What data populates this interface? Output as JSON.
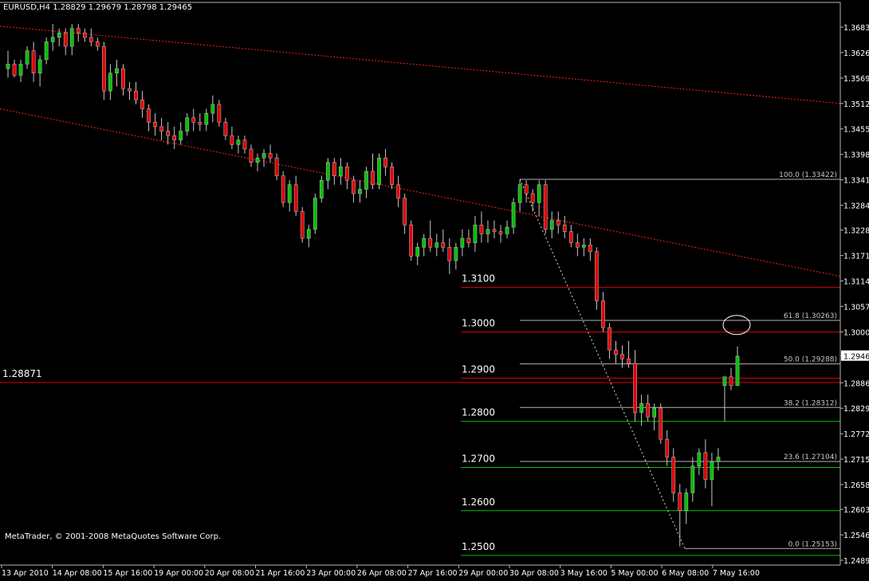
{
  "window": {
    "title": "EURUSD,H4  1.28829 1.29679 1.28798 1.29465",
    "copyright": "MetaTrader, © 2001-2008 MetaQuotes Software Corp."
  },
  "colors": {
    "background": "#000000",
    "bull": "#00c000",
    "bear": "#e00000",
    "level_red": "#e00000",
    "level_green": "#00c000",
    "fib": "#b4b4b4",
    "trend": "#ff2020",
    "axis": "#b4b4b4"
  },
  "chart_data": {
    "type": "candlestick",
    "symbol": "EURUSD",
    "timeframe": "H4",
    "ohlc_header": {
      "open": 1.28829,
      "high": 1.29679,
      "low": 1.28798,
      "close": 1.29465
    },
    "ylim": [
      1.2489,
      1.3683
    ],
    "price_ticks": [
      "1.36830",
      "1.36260",
      "1.35690",
      "1.35120",
      "1.34550",
      "1.33980",
      "1.33410",
      "1.32840",
      "1.32285",
      "1.31715",
      "1.31145",
      "1.30575",
      "1.30005",
      "1.29465",
      "1.28865",
      "1.28295",
      "1.27725",
      "1.27155",
      "1.26585",
      "1.26030",
      "1.25460",
      "1.24890"
    ],
    "current_price_label": "1.29465",
    "time_ticks": [
      "13 Apr 2010",
      "14 Apr 08:00",
      "15 Apr 16:00",
      "19 Apr 00:00",
      "20 Apr 08:00",
      "21 Apr 16:00",
      "23 Apr 00:00",
      "26 Apr 08:00",
      "27 Apr 16:00",
      "29 Apr 00:00",
      "30 Apr 08:00",
      "3 May 16:00",
      "5 May 00:00",
      "6 May 08:00",
      "7 May 16:00"
    ],
    "horizontal_levels": [
      {
        "label": "1.3100",
        "price": 1.31,
        "color": "red"
      },
      {
        "label": "1.3000",
        "price": 1.3,
        "color": "red"
      },
      {
        "label": "1.2900",
        "price": 1.2897,
        "color": "red"
      },
      {
        "label": "1.2800",
        "price": 1.28,
        "color": "green"
      },
      {
        "label": "1.2700",
        "price": 1.2697,
        "color": "green"
      },
      {
        "label": "1.2600",
        "price": 1.26,
        "color": "green"
      },
      {
        "label": "1.2500",
        "price": 1.25,
        "color": "green"
      }
    ],
    "marked_level": {
      "label": "1.28871",
      "price": 1.28871
    },
    "fibonacci": [
      {
        "label": "100.0 (1.33422)",
        "price": 1.33422
      },
      {
        "label": "61.8 (1.30263)",
        "price": 1.30263
      },
      {
        "label": "50.0 (1.29288)",
        "price": 1.29288
      },
      {
        "label": "38.2 (1.28312)",
        "price": 1.28312
      },
      {
        "label": "23.6 (1.27104)",
        "price": 1.27104
      },
      {
        "label": "0.0 (1.25153)",
        "price": 1.25153
      }
    ],
    "candles": [
      [
        1.359,
        1.363,
        1.357,
        1.36
      ],
      [
        1.36,
        1.361,
        1.357,
        1.3575
      ],
      [
        1.3575,
        1.361,
        1.356,
        1.36
      ],
      [
        1.36,
        1.364,
        1.359,
        1.363
      ],
      [
        1.363,
        1.365,
        1.356,
        1.358
      ],
      [
        1.358,
        1.362,
        1.355,
        1.361
      ],
      [
        1.361,
        1.366,
        1.36,
        1.365
      ],
      [
        1.365,
        1.369,
        1.363,
        1.366
      ],
      [
        1.366,
        1.368,
        1.364,
        1.367
      ],
      [
        1.367,
        1.368,
        1.362,
        1.364
      ],
      [
        1.364,
        1.369,
        1.362,
        1.368
      ],
      [
        1.368,
        1.369,
        1.365,
        1.367
      ],
      [
        1.367,
        1.368,
        1.365,
        1.366
      ],
      [
        1.366,
        1.368,
        1.364,
        1.365
      ],
      [
        1.365,
        1.366,
        1.363,
        1.364
      ],
      [
        1.364,
        1.365,
        1.352,
        1.354
      ],
      [
        1.354,
        1.36,
        1.352,
        1.358
      ],
      [
        1.358,
        1.361,
        1.355,
        1.359
      ],
      [
        1.359,
        1.36,
        1.353,
        1.3545
      ],
      [
        1.3545,
        1.356,
        1.352,
        1.354
      ],
      [
        1.354,
        1.356,
        1.351,
        1.352
      ],
      [
        1.352,
        1.354,
        1.348,
        1.35
      ],
      [
        1.35,
        1.351,
        1.345,
        1.347
      ],
      [
        1.347,
        1.349,
        1.344,
        1.346
      ],
      [
        1.346,
        1.348,
        1.343,
        1.345
      ],
      [
        1.345,
        1.347,
        1.342,
        1.344
      ],
      [
        1.344,
        1.346,
        1.341,
        1.343
      ],
      [
        1.343,
        1.347,
        1.342,
        1.345
      ],
      [
        1.345,
        1.349,
        1.344,
        1.348
      ],
      [
        1.348,
        1.35,
        1.345,
        1.347
      ],
      [
        1.347,
        1.349,
        1.345,
        1.3465
      ],
      [
        1.3465,
        1.35,
        1.345,
        1.349
      ],
      [
        1.349,
        1.353,
        1.347,
        1.351
      ],
      [
        1.351,
        1.352,
        1.346,
        1.347
      ],
      [
        1.347,
        1.348,
        1.343,
        1.344
      ],
      [
        1.344,
        1.346,
        1.341,
        1.342
      ],
      [
        1.342,
        1.344,
        1.34,
        1.343
      ],
      [
        1.343,
        1.344,
        1.34,
        1.341
      ],
      [
        1.341,
        1.342,
        1.337,
        1.338
      ],
      [
        1.338,
        1.34,
        1.336,
        1.339
      ],
      [
        1.339,
        1.341,
        1.337,
        1.34
      ],
      [
        1.34,
        1.342,
        1.338,
        1.339
      ],
      [
        1.339,
        1.34,
        1.334,
        1.335
      ],
      [
        1.335,
        1.336,
        1.328,
        1.329
      ],
      [
        1.329,
        1.334,
        1.327,
        1.333
      ],
      [
        1.333,
        1.335,
        1.326,
        1.327
      ],
      [
        1.327,
        1.328,
        1.32,
        1.321
      ],
      [
        1.321,
        1.324,
        1.319,
        1.323
      ],
      [
        1.323,
        1.331,
        1.322,
        1.33
      ],
      [
        1.33,
        1.335,
        1.329,
        1.334
      ],
      [
        1.334,
        1.339,
        1.332,
        1.338
      ],
      [
        1.338,
        1.339,
        1.333,
        1.335
      ],
      [
        1.335,
        1.339,
        1.333,
        1.337
      ],
      [
        1.337,
        1.338,
        1.332,
        1.334
      ],
      [
        1.334,
        1.335,
        1.329,
        1.331
      ],
      [
        1.331,
        1.334,
        1.329,
        1.332
      ],
      [
        1.332,
        1.337,
        1.33,
        1.336
      ],
      [
        1.336,
        1.34,
        1.332,
        1.333
      ],
      [
        1.333,
        1.34,
        1.332,
        1.339
      ],
      [
        1.339,
        1.341,
        1.335,
        1.337
      ],
      [
        1.337,
        1.338,
        1.332,
        1.333
      ],
      [
        1.333,
        1.335,
        1.328,
        1.33
      ],
      [
        1.33,
        1.331,
        1.322,
        1.324
      ],
      [
        1.324,
        1.325,
        1.316,
        1.317
      ],
      [
        1.317,
        1.32,
        1.315,
        1.319
      ],
      [
        1.319,
        1.322,
        1.317,
        1.321
      ],
      [
        1.321,
        1.325,
        1.318,
        1.319
      ],
      [
        1.319,
        1.322,
        1.317,
        1.32
      ],
      [
        1.32,
        1.323,
        1.318,
        1.319
      ],
      [
        1.319,
        1.321,
        1.313,
        1.316
      ],
      [
        1.316,
        1.32,
        1.314,
        1.319
      ],
      [
        1.319,
        1.323,
        1.317,
        1.321
      ],
      [
        1.321,
        1.323,
        1.319,
        1.32
      ],
      [
        1.32,
        1.326,
        1.318,
        1.324
      ],
      [
        1.324,
        1.327,
        1.32,
        1.322
      ],
      [
        1.322,
        1.325,
        1.32,
        1.323
      ],
      [
        1.323,
        1.325,
        1.321,
        1.3225
      ],
      [
        1.3225,
        1.324,
        1.32,
        1.322
      ],
      [
        1.322,
        1.325,
        1.321,
        1.3235
      ],
      [
        1.3235,
        1.33,
        1.322,
        1.329
      ],
      [
        1.329,
        1.334,
        1.327,
        1.333
      ],
      [
        1.333,
        1.334,
        1.329,
        1.331
      ],
      [
        1.331,
        1.332,
        1.327,
        1.329
      ],
      [
        1.329,
        1.334,
        1.326,
        1.333
      ],
      [
        1.333,
        1.334,
        1.322,
        1.323
      ],
      [
        1.323,
        1.327,
        1.321,
        1.325
      ],
      [
        1.325,
        1.327,
        1.322,
        1.324
      ],
      [
        1.324,
        1.326,
        1.321,
        1.3225
      ],
      [
        1.3225,
        1.324,
        1.319,
        1.32
      ],
      [
        1.32,
        1.322,
        1.317,
        1.319
      ],
      [
        1.319,
        1.321,
        1.317,
        1.3195
      ],
      [
        1.3195,
        1.321,
        1.316,
        1.318
      ],
      [
        1.318,
        1.319,
        1.305,
        1.307
      ],
      [
        1.307,
        1.309,
        1.3,
        1.301
      ],
      [
        1.301,
        1.302,
        1.294,
        1.296
      ],
      [
        1.296,
        1.298,
        1.293,
        1.295
      ],
      [
        1.295,
        1.297,
        1.292,
        1.294
      ],
      [
        1.294,
        1.298,
        1.292,
        1.293
      ],
      [
        1.293,
        1.296,
        1.28,
        1.282
      ],
      [
        1.282,
        1.286,
        1.279,
        1.284
      ],
      [
        1.284,
        1.286,
        1.28,
        1.281
      ],
      [
        1.281,
        1.284,
        1.278,
        1.283
      ],
      [
        1.283,
        1.284,
        1.275,
        1.276
      ],
      [
        1.276,
        1.278,
        1.27,
        1.272
      ],
      [
        1.272,
        1.274,
        1.262,
        1.264
      ],
      [
        1.264,
        1.266,
        1.252,
        1.26
      ],
      [
        1.26,
        1.265,
        1.257,
        1.264
      ],
      [
        1.264,
        1.272,
        1.262,
        1.27
      ],
      [
        1.27,
        1.274,
        1.268,
        1.273
      ],
      [
        1.273,
        1.276,
        1.265,
        1.267
      ],
      [
        1.267,
        1.273,
        1.261,
        1.271
      ],
      [
        1.271,
        1.274,
        1.269,
        1.272
      ],
      [
        1.288,
        1.29,
        1.28,
        1.29
      ],
      [
        1.29,
        1.292,
        1.287,
        1.288
      ],
      [
        1.288,
        1.2968,
        1.288,
        1.2946
      ]
    ],
    "annotations": [
      "circle near the 1.3000 level at the 61.8 retracement",
      "dotted line from the 100.0 swing high to the 0.0 swing low"
    ]
  }
}
